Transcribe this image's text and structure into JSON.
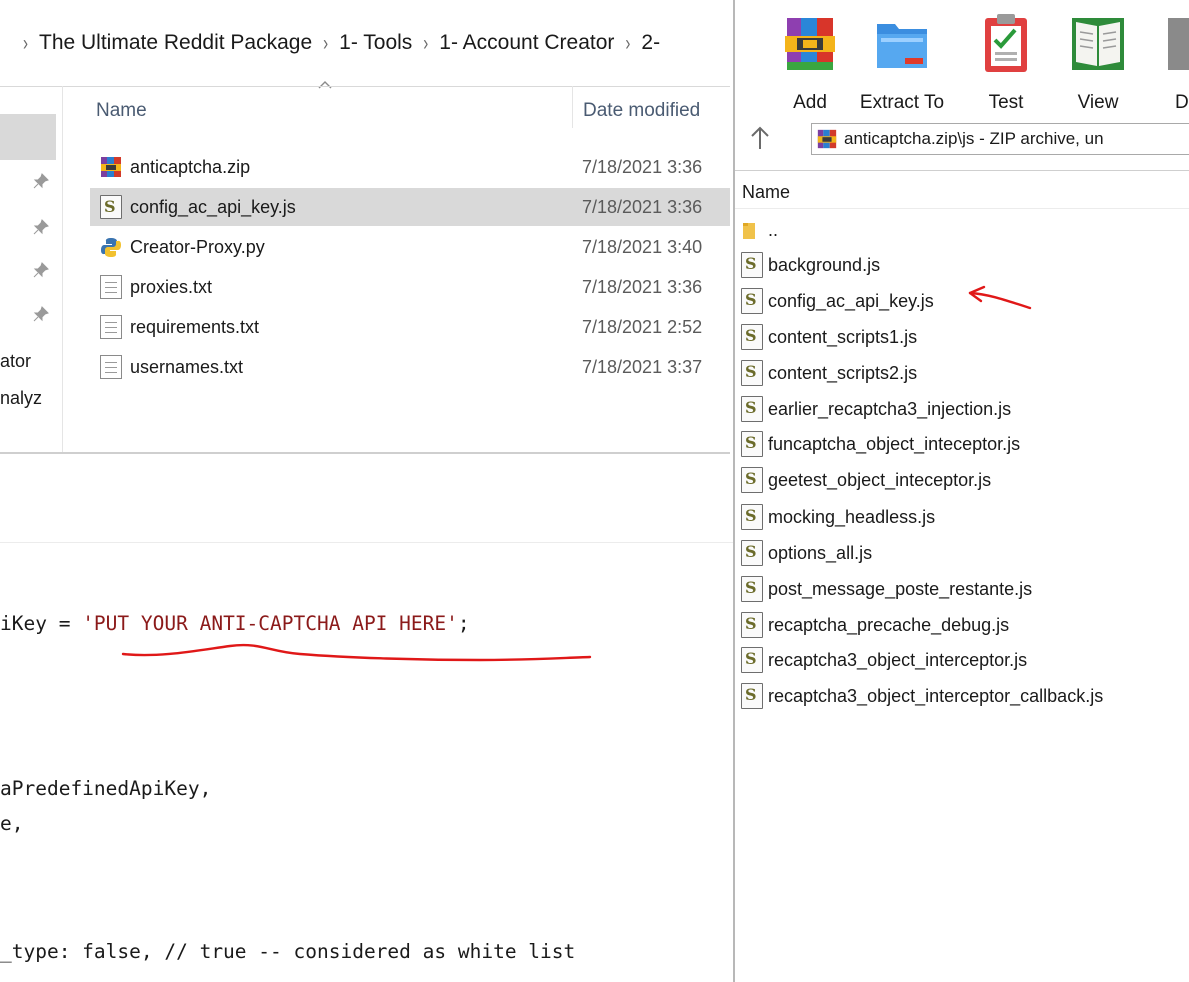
{
  "explorer": {
    "breadcrumb": [
      "The Ultimate Reddit Package",
      "1- Tools",
      "1- Account Creator",
      "2-"
    ],
    "columns": {
      "name": "Name",
      "date_modified": "Date modified"
    },
    "nav_fragments": [
      "ator",
      "nalyz"
    ],
    "files": [
      {
        "name": "anticaptcha.zip",
        "date": "7/18/2021 3:36",
        "icon": "winrar-archive-icon",
        "selected": false
      },
      {
        "name": "config_ac_api_key.js",
        "date": "7/18/2021 3:36",
        "icon": "javascript-file-icon",
        "selected": true
      },
      {
        "name": "Creator-Proxy.py",
        "date": "7/18/2021 3:40",
        "icon": "python-file-icon",
        "selected": false
      },
      {
        "name": "proxies.txt",
        "date": "7/18/2021 3:36",
        "icon": "text-file-icon",
        "selected": false
      },
      {
        "name": "requirements.txt",
        "date": "7/18/2021 2:52",
        "icon": "text-file-icon",
        "selected": false
      },
      {
        "name": "usernames.txt",
        "date": "7/18/2021 3:37",
        "icon": "text-file-icon",
        "selected": false
      }
    ]
  },
  "code": {
    "line1_prefix": "iKey = ",
    "line1_string": "'PUT YOUR ANTI-CAPTCHA API HERE'",
    "line1_suffix": ";",
    "line2": "aPredefinedApiKey,",
    "line3": "e,",
    "line4": "_type: false, // true -- considered as white list"
  },
  "winrar": {
    "toolbar": [
      {
        "label": "Add",
        "icon": "add-archive-icon"
      },
      {
        "label": "Extract To",
        "icon": "extract-folder-icon"
      },
      {
        "label": "Test",
        "icon": "test-clipboard-icon"
      },
      {
        "label": "View",
        "icon": "view-book-icon"
      },
      {
        "label": "D",
        "icon": "delete-icon"
      }
    ],
    "address": "anticaptcha.zip\\js - ZIP archive, un",
    "column_name": "Name",
    "parent_entry": "..",
    "files": [
      "background.js",
      "config_ac_api_key.js",
      "content_scripts1.js",
      "content_scripts2.js",
      "earlier_recaptcha3_injection.js",
      "funcaptcha_object_inteceptor.js",
      "geetest_object_inteceptor.js",
      "mocking_headless.js",
      "options_all.js",
      "post_message_poste_restante.js",
      "recaptcha_precache_debug.js",
      "recaptcha3_object_interceptor.js",
      "recaptcha3_object_interceptor_callback.js"
    ]
  },
  "colors": {
    "selection": "#d9d9d9",
    "header_text": "#4a5b72",
    "annotation_red": "#e01818",
    "code_string": "#8b1a1a"
  }
}
